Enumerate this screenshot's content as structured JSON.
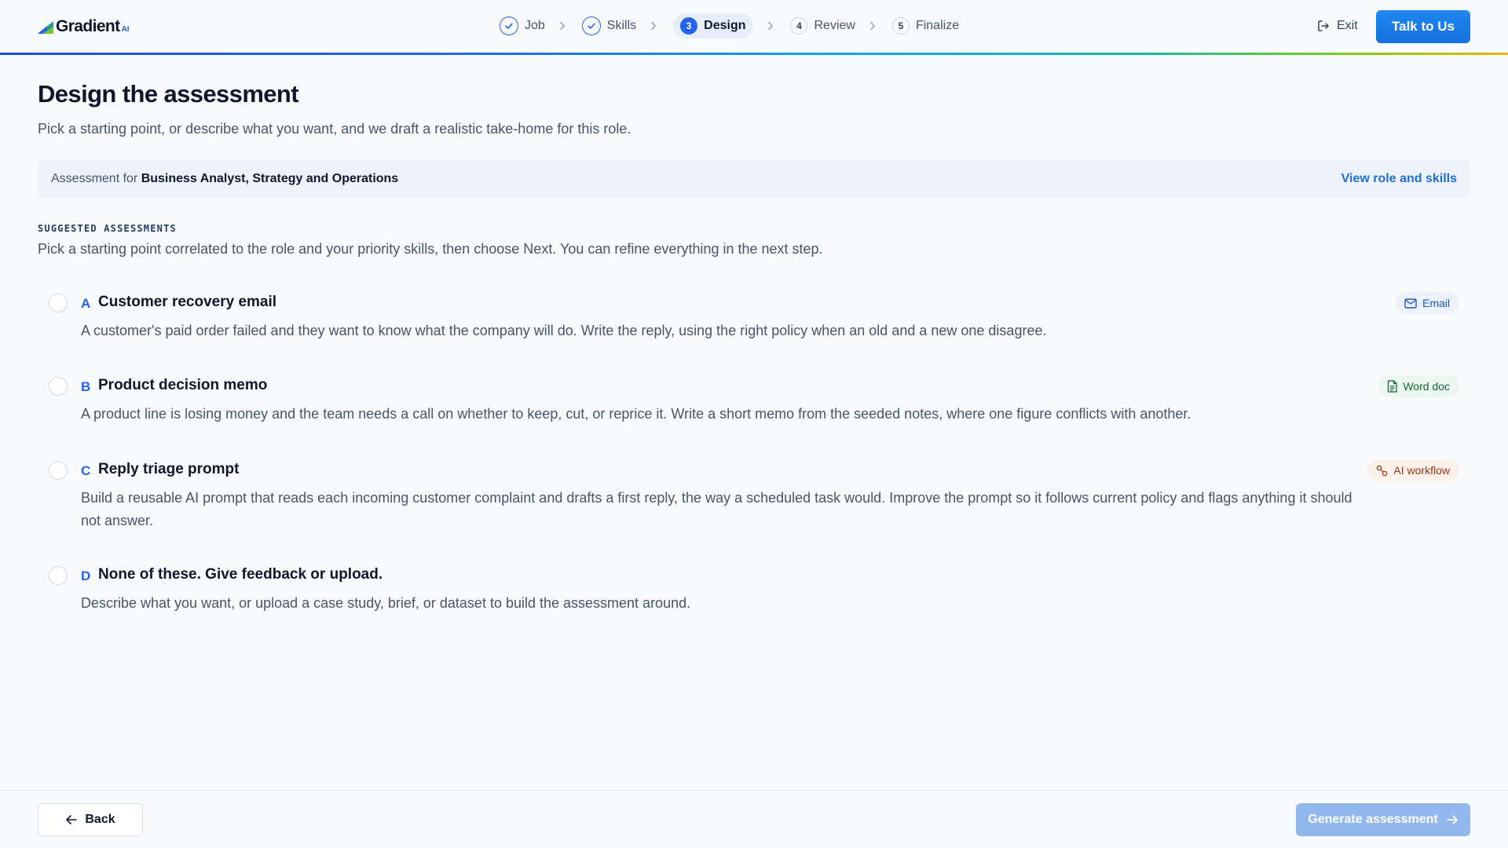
{
  "brand": {
    "name": "Gradient",
    "suffix": "AI"
  },
  "stepper": {
    "steps": [
      {
        "number": "1",
        "label": "Job",
        "state": "done"
      },
      {
        "number": "2",
        "label": "Skills",
        "state": "done"
      },
      {
        "number": "3",
        "label": "Design",
        "state": "current"
      },
      {
        "number": "4",
        "label": "Review",
        "state": "upcoming"
      },
      {
        "number": "5",
        "label": "Finalize",
        "state": "upcoming"
      }
    ]
  },
  "header": {
    "exit_label": "Exit",
    "cta_label": "Talk to Us"
  },
  "main": {
    "title": "Design the assessment",
    "subtitle": "Pick a starting point, or describe what you want, and we draft a realistic take-home for this role.",
    "role_bar": {
      "prefix": "Assessment for ",
      "role": "Business Analyst, Strategy and Operations",
      "link": "View role and skills"
    },
    "section": {
      "label": "SUGGESTED ASSESSMENTS",
      "description": "Pick a starting point correlated to the role and your priority skills, then choose Next. You can refine everything in the next step."
    },
    "options": [
      {
        "letter": "A",
        "title": "Customer recovery email",
        "description": "A customer's paid order failed and they want to know what the company will do. Write the reply, using the right policy when an old and a new one disagree.",
        "tag": "Email",
        "tag_icon": "mail-icon"
      },
      {
        "letter": "B",
        "title": "Product decision memo",
        "description": "A product line is losing money and the team needs a call on whether to keep, cut, or reprice it. Write a short memo from the seeded notes, where one figure conflicts with another.",
        "tag": "Word doc",
        "tag_icon": "document-icon"
      },
      {
        "letter": "C",
        "title": "Reply triage prompt",
        "description": "Build a reusable AI prompt that reads each incoming customer complaint and drafts a first reply, the way a scheduled task would. Improve the prompt so it follows current policy and flags anything it should not answer.",
        "tag": "AI workflow",
        "tag_icon": "workflow-icon"
      },
      {
        "letter": "D",
        "title": "None of these. Give feedback or upload.",
        "description": "Describe what you want, or upload a case study, brief, or dataset to build the assessment around."
      }
    ]
  },
  "footer": {
    "back_label": "Back",
    "generate_label": "Generate assessment"
  },
  "colors": {
    "accent": "#2563eb",
    "cta": "#1677e6",
    "disabled_cta": "#93b8ef"
  }
}
